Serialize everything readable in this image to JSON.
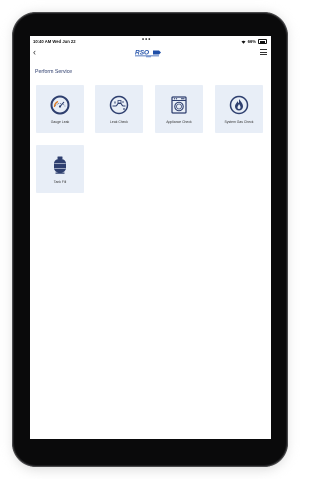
{
  "status_bar": {
    "time_date": "10:40 AM   Wed Jun 22",
    "battery": "66%"
  },
  "header": {
    "logo_text": "RSO"
  },
  "section": {
    "title": "Perform Service"
  },
  "tiles": [
    {
      "label": "Gauge Leak",
      "icon": "gauge-icon"
    },
    {
      "label": "Leak Check",
      "icon": "leak-check-icon"
    },
    {
      "label": "Appliance Check",
      "icon": "appliance-icon"
    },
    {
      "label": "System Gas Check",
      "icon": "gas-flame-icon"
    },
    {
      "label": "Tank Fill",
      "icon": "propane-tank-icon"
    }
  ],
  "colors": {
    "tile_bg": "#e8eef7",
    "icon_ring": "#2e3f6f",
    "brand_blue": "#1f4fa8"
  }
}
